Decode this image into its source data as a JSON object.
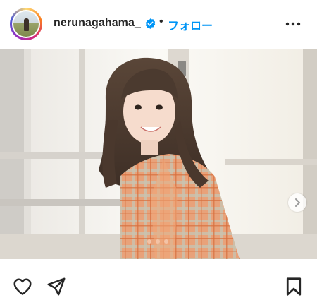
{
  "post": {
    "username": "nerunagahama_",
    "separator": "•",
    "follow_label": "フォロー",
    "verified": true
  },
  "icons": {
    "verified": "verified-badge-icon",
    "more": "more-options-icon",
    "like": "heart-icon",
    "share": "paper-plane-icon",
    "save": "bookmark-icon",
    "next": "chevron-right-icon"
  },
  "colors": {
    "follow": "#0095f6",
    "verified": "#0095f6",
    "text": "#262626"
  }
}
